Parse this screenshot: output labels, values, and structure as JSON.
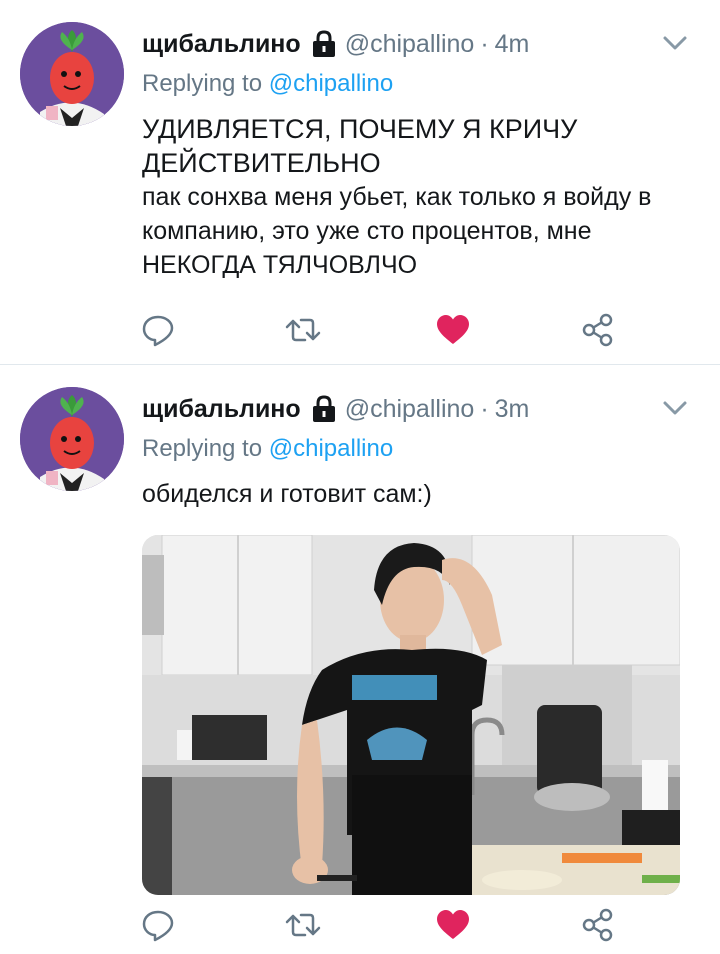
{
  "tweets": [
    {
      "display_name": "щибальлино",
      "handle": "@chipallino",
      "separator": "·",
      "time": "4m",
      "replying_prefix": "Replying to",
      "replying_to": "@chipallino",
      "text_line1": "УДИВЛЯЕТСЯ, ПОЧЕМУ Я КРИЧУ ДЕЙСТВИТЕЛЬНО",
      "text_line2": "пак сонхва меня убьет, как только я войду в компанию, это уже сто процентов, мне НЕКОГДА  ТЯЛЧОВЛЧО",
      "liked": true
    },
    {
      "display_name": "щибальлино",
      "handle": "@chipallino",
      "separator": "·",
      "time": "3m",
      "replying_prefix": "Replying to",
      "replying_to": "@chipallino",
      "text": "обиделся и готовит сам:)",
      "has_media": true,
      "liked": true
    }
  ],
  "icons": {
    "lock": "lock-icon",
    "caret": "chevron-down-icon",
    "reply": "reply-icon",
    "retweet": "retweet-icon",
    "like": "heart-icon",
    "share": "share-icon"
  },
  "colors": {
    "link": "#1da1f2",
    "secondary": "#657786",
    "like": "#e0245e",
    "icon": "#657786"
  }
}
